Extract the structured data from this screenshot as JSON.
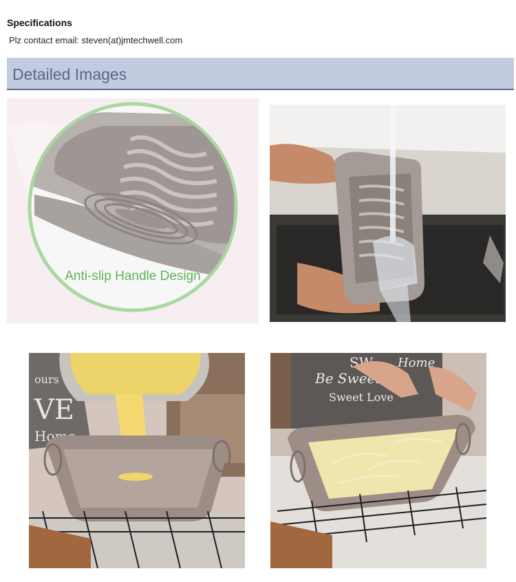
{
  "specifications": {
    "title": "Specifications",
    "contact": "Plz contact email: steven(at)jmtechwell.com"
  },
  "detailed_images": {
    "title": "Detailed Images",
    "images": [
      {
        "caption": "Anti-slip Handle Design",
        "subject": "loaf-pan-handle-closeup"
      },
      {
        "subject": "loaf-pan-washed-under-tap"
      },
      {
        "subject": "batter-poured-into-loaf-pan"
      },
      {
        "subject": "loaf-pan-with-dough-on-rack",
        "apron_text": [
          "Be Sweet",
          "Sweet Love",
          "Home",
          "SW"
        ]
      }
    ],
    "apron_left_text": [
      "ours",
      "VE",
      "Home"
    ]
  },
  "colors": {
    "header_band": "#c3cbe0",
    "header_text": "#5a6784",
    "silicone": "#9b908c",
    "circle_outline": "#a9d8a3",
    "caption_green": "#5cb55a"
  }
}
